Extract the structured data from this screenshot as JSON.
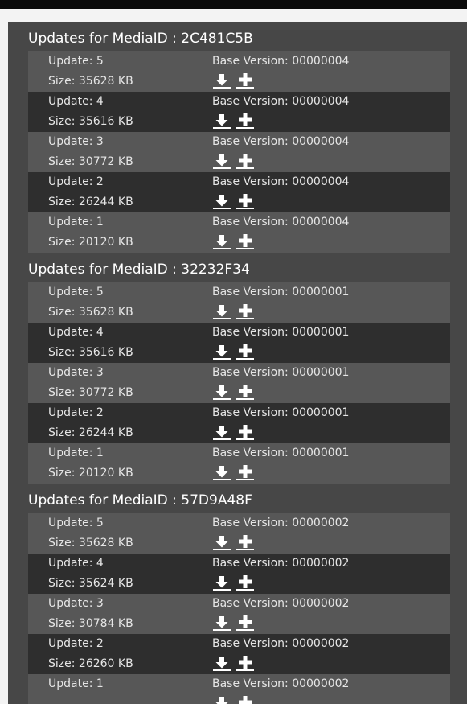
{
  "labels": {
    "group_prefix": "Updates for MediaID : ",
    "update_prefix": "Update: ",
    "size_prefix": "Size: ",
    "base_prefix": "Base Version: "
  },
  "icons": {
    "download": "download-icon",
    "add": "plus-icon"
  },
  "colors": {
    "panel": "#474747",
    "row_light": "#575757",
    "row_dark": "#2e2e2e",
    "text": "#e6e6e6"
  },
  "groups": [
    {
      "media_id": "2C481C5B",
      "updates": [
        {
          "update": "5",
          "size": "35628 KB",
          "base_version": "00000004"
        },
        {
          "update": "4",
          "size": "35616 KB",
          "base_version": "00000004"
        },
        {
          "update": "3",
          "size": "30772 KB",
          "base_version": "00000004"
        },
        {
          "update": "2",
          "size": "26244 KB",
          "base_version": "00000004"
        },
        {
          "update": "1",
          "size": "20120 KB",
          "base_version": "00000004"
        }
      ]
    },
    {
      "media_id": "32232F34",
      "updates": [
        {
          "update": "5",
          "size": "35628 KB",
          "base_version": "00000001"
        },
        {
          "update": "4",
          "size": "35616 KB",
          "base_version": "00000001"
        },
        {
          "update": "3",
          "size": "30772 KB",
          "base_version": "00000001"
        },
        {
          "update": "2",
          "size": "26244 KB",
          "base_version": "00000001"
        },
        {
          "update": "1",
          "size": "20120 KB",
          "base_version": "00000001"
        }
      ]
    },
    {
      "media_id": "57D9A48F",
      "updates": [
        {
          "update": "5",
          "size": "35628 KB",
          "base_version": "00000002"
        },
        {
          "update": "4",
          "size": "35624 KB",
          "base_version": "00000002"
        },
        {
          "update": "3",
          "size": "30784 KB",
          "base_version": "00000002"
        },
        {
          "update": "2",
          "size": "26260 KB",
          "base_version": "00000002"
        },
        {
          "update": "1",
          "size": "",
          "base_version": "00000002"
        }
      ]
    }
  ]
}
